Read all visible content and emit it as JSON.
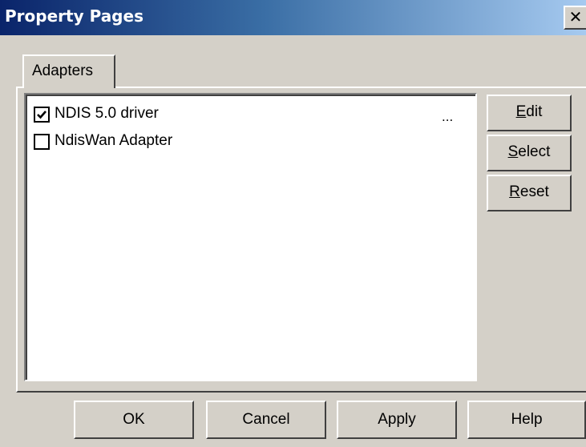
{
  "window": {
    "title": "Property Pages",
    "close_glyph": "✕"
  },
  "tabs": [
    {
      "label": "Adapters",
      "selected": true
    }
  ],
  "adapters": {
    "items": [
      {
        "label": "NDIS 5.0 driver",
        "checked": true
      },
      {
        "label": "NdisWan Adapter",
        "checked": false
      }
    ],
    "more_indicator": "..."
  },
  "side_buttons": {
    "edit": {
      "first": "E",
      "rest": "dit"
    },
    "select": {
      "first": "S",
      "rest": "elect"
    },
    "reset": {
      "first": "R",
      "rest": "eset"
    }
  },
  "bottom_buttons": {
    "ok": "OK",
    "cancel": "Cancel",
    "apply": "Apply",
    "help": "Help"
  },
  "icons": {
    "checkbox_checked": "check-mark-icon",
    "close": "close-icon"
  },
  "colors": {
    "title_gradient_start": "#0a246a",
    "title_gradient_end": "#a6caf0",
    "dialog_bg": "#d4d0c8",
    "list_bg": "#ffffff"
  }
}
